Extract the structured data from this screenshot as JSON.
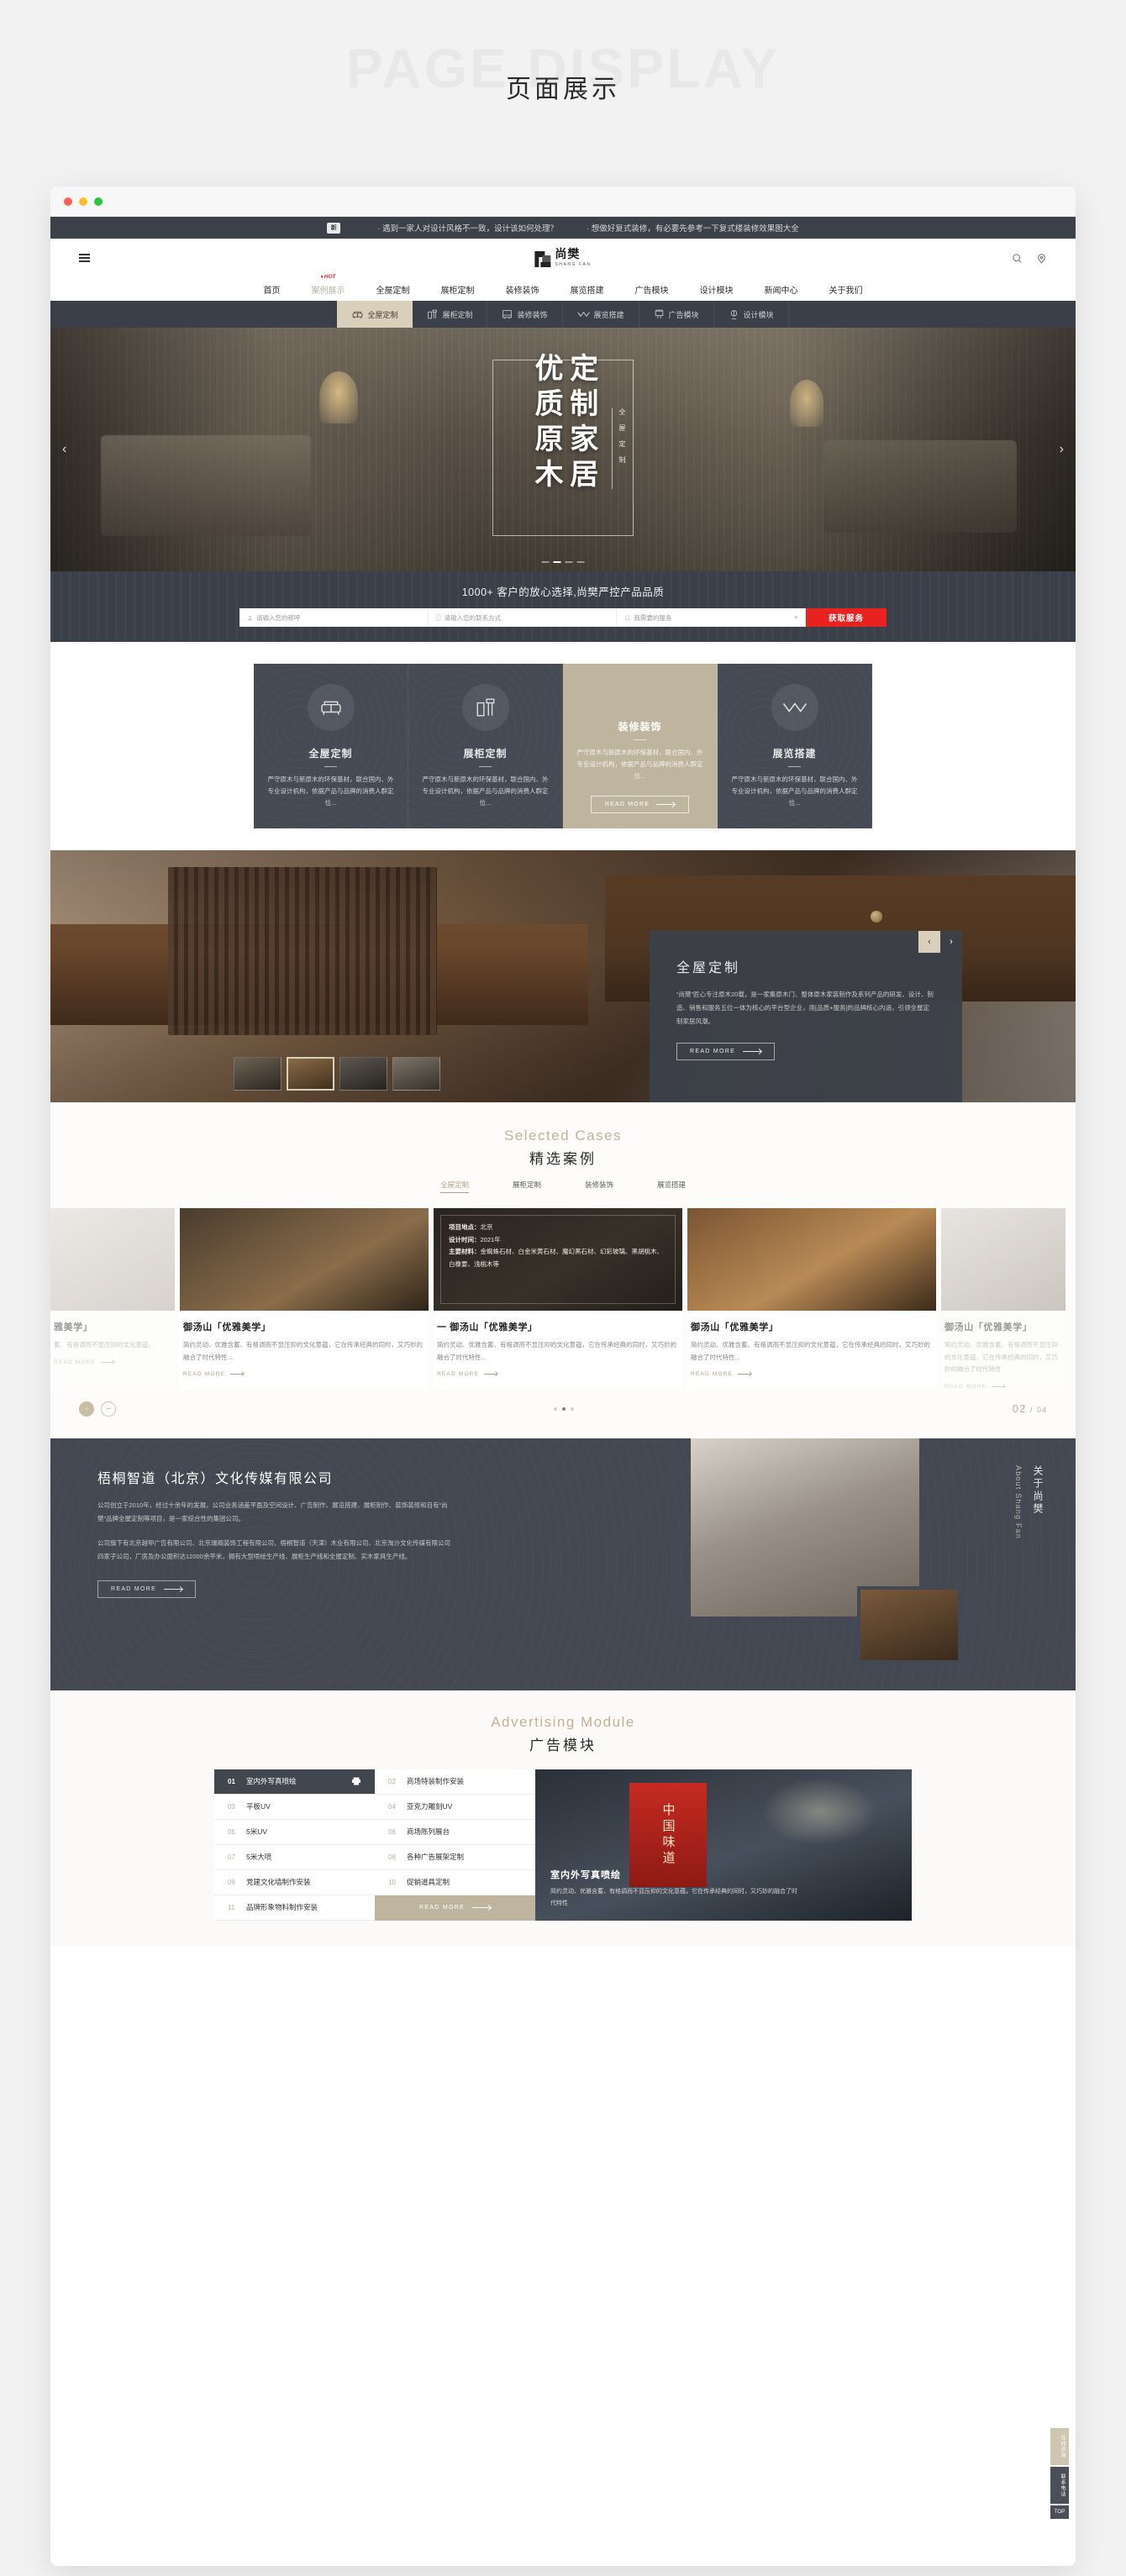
{
  "page_header": {
    "watermark_en": "PAGE DISPLAY",
    "watermark_cn": "页面展示"
  },
  "announcement": {
    "badge": "新",
    "items": [
      "· 遇到一家人对设计风格不一致，设计该如何处理？",
      "· 想做好复式装修，有必要先参考一下复式楼装修效果图大全"
    ]
  },
  "brand": {
    "name_cn": "尚樊",
    "name_en": "SHANG FAN"
  },
  "top_icons": {
    "menu": "hamburger-icon",
    "search": "search-icon",
    "location": "location-icon"
  },
  "main_nav": {
    "items": [
      {
        "label": "首页",
        "active": false,
        "badge": ""
      },
      {
        "label": "案例展示",
        "active": true,
        "badge": "HOT"
      },
      {
        "label": "全屋定制",
        "active": false,
        "badge": ""
      },
      {
        "label": "展柜定制",
        "active": false,
        "badge": ""
      },
      {
        "label": "装修装饰",
        "active": false,
        "badge": ""
      },
      {
        "label": "展览搭建",
        "active": false,
        "badge": ""
      },
      {
        "label": "广告模块",
        "active": false,
        "badge": ""
      },
      {
        "label": "设计模块",
        "active": false,
        "badge": ""
      },
      {
        "label": "新闻中心",
        "active": false,
        "badge": ""
      },
      {
        "label": "关于我们",
        "active": false,
        "badge": ""
      }
    ]
  },
  "category_tabs": {
    "items": [
      {
        "label": "全屋定制",
        "icon": "sofa-icon",
        "selected": true
      },
      {
        "label": "展柜定制",
        "icon": "cabinet-icon",
        "selected": false
      },
      {
        "label": "装修装饰",
        "icon": "decor-icon",
        "selected": false
      },
      {
        "label": "展览搭建",
        "icon": "exhibition-icon",
        "selected": false
      },
      {
        "label": "广告模块",
        "icon": "billboard-icon",
        "selected": false
      },
      {
        "label": "设计模块",
        "icon": "design-icon",
        "selected": false
      }
    ]
  },
  "hero": {
    "line1": "优质原木",
    "line2": "定制家居",
    "vertical_sub": "全屋定制",
    "prev": "‹",
    "next": "›",
    "slide_count": 4,
    "active_slide": 2
  },
  "cta": {
    "title": "1000+ 客户的放心选择,尚樊严控产品品质",
    "name_placeholder": "请输入您的称呼",
    "phone_placeholder": "请输入您的联系方式",
    "service_placeholder": "我需要的服务",
    "button": "获取服务"
  },
  "services": {
    "body": "严守原木与新原木的环保基材，联合国内、外专业设计机构，依据产品与品牌的消费人群定位...",
    "read_more": "READ MORE",
    "cards": [
      {
        "title": "全屋定制",
        "icon": "sofa-icon",
        "highlight": false
      },
      {
        "title": "展柜定制",
        "icon": "cabinet-icon",
        "highlight": false
      },
      {
        "title": "装修装饰",
        "icon": "decor-icon",
        "highlight": true
      },
      {
        "title": "展览搭建",
        "icon": "exhibition-icon",
        "highlight": false
      }
    ]
  },
  "feature": {
    "title": "全屋定制",
    "body": "“尚樊”匠心专注原木20载，是一家集原木门、整体原木家装制作及系列产品的研发、设计、制造、销售和服务五位一体为核心的平台型企业，用[品质+服务]的品牌核心内涵，引领全屋定制家居风潮。",
    "read_more": "READ MORE",
    "prev": "‹",
    "next": "›"
  },
  "cases": {
    "section_en": "Selected Cases",
    "section_cn": "精选案例",
    "tabs": [
      {
        "label": "全屋定制",
        "active": true
      },
      {
        "label": "展柜定制",
        "active": false
      },
      {
        "label": "装修装饰",
        "active": false
      },
      {
        "label": "展览搭建",
        "active": false
      }
    ],
    "overlay": {
      "location_label": "项目地点：",
      "location_value": "北京",
      "time_label": "设计时间：",
      "time_value": "2021年",
      "material_label": "主要材料：",
      "material_value": "金蜘蛛石材、白金米黄石材、魔幻黑石材、幻彩玻璃、黑胡桃木、白橡要、浅桃木等"
    },
    "items": [
      {
        "title": "雅美学」",
        "desc": "蓄、有格调而不显压抑的文化意蕴，",
        "read_more": "READ MORE"
      },
      {
        "title": "御汤山「优雅美学」",
        "desc": "简约灵动、优雅含蓄、有格调而不显压抑的文化意蕴，它在传承经典的同时，又巧妙的融合了时代特性...",
        "read_more": "READ MORE"
      },
      {
        "title": "一 御汤山「优雅美学」",
        "desc": "简约灵动、优雅含蓄、有格调而不显压抑的文化意蕴，它在传承经典的同时，又巧妙的融合了时代特性...",
        "read_more": "READ MORE"
      },
      {
        "title": "御汤山「优雅美学」",
        "desc": "简约灵动、优雅含蓄、有格调而不显压抑的文化意蕴，它在传承经典的同时，又巧妙的融合了时代特性...",
        "read_more": "READ MORE"
      },
      {
        "title": "御汤山「优雅美学」",
        "desc": "简约灵动、优雅含蓄、有格调而不显压抑的文化意蕴，它在传承经典的同时，又巧妙的融合了时代特性",
        "read_more": "READ MORE"
      }
    ],
    "counter_current": "02",
    "counter_sep": "/",
    "counter_total": "04",
    "prev": "‹",
    "next": "－"
  },
  "about": {
    "title": "梧桐智道（北京）文化传媒有限公司",
    "paragraph1": "公司创立于2010年，经过十余年的发展，公司业务涵盖平面及空间设计、广告制作、展览搭建、展柜制作、装饰装修和自有“尚樊”品牌全屋定制等项目，是一家综合性的集团公司。",
    "paragraph2": "公司旗下有北京越甲广告有限公司、北京瑞阁装饰工程有限公司、梧桐智道（天津）木业有限公司、北京淘沙文化传媒有限公司四家子公司，厂房及办公面积达12000余平米，拥有大型喷绘生产线、展柜生产线和全屋定制、实木家具生产线。",
    "read_more": "READ MORE",
    "vertical_cn": "关于尚樊",
    "vertical_en": "About Shang Fan"
  },
  "advertising": {
    "section_en": "Advertising Module",
    "section_cn": "广告模块",
    "read_more": "READ MORE",
    "items": [
      {
        "no": "01",
        "label": "室内外写真喷绘",
        "active": true
      },
      {
        "no": "02",
        "label": "商场特装制作安装",
        "active": false
      },
      {
        "no": "03",
        "label": "平板UV",
        "active": false
      },
      {
        "no": "04",
        "label": "亚克力雕刻UV",
        "active": false
      },
      {
        "no": "05",
        "label": "5米UV",
        "active": false
      },
      {
        "no": "06",
        "label": "商场陈列展台",
        "active": false
      },
      {
        "no": "07",
        "label": "5米大喷",
        "active": false
      },
      {
        "no": "08",
        "label": "各种广告展架定制",
        "active": false
      },
      {
        "no": "09",
        "label": "党建文化墙制作安装",
        "active": false
      },
      {
        "no": "10",
        "label": "促销道具定制",
        "active": false
      },
      {
        "no": "11",
        "label": "品牌形象物料制作安装",
        "active": false
      }
    ],
    "card": {
      "poster_text": "中国味道",
      "title": "室内外写真喷绘",
      "desc": "简约灵动、优雅含蓄、有格调而不显压抑的文化意蕴，它在传承经典的同时，又巧妙的融合了时代特性"
    }
  },
  "rail": {
    "buttons": [
      "在线咨询",
      "联系电话"
    ],
    "top": "TOP"
  }
}
